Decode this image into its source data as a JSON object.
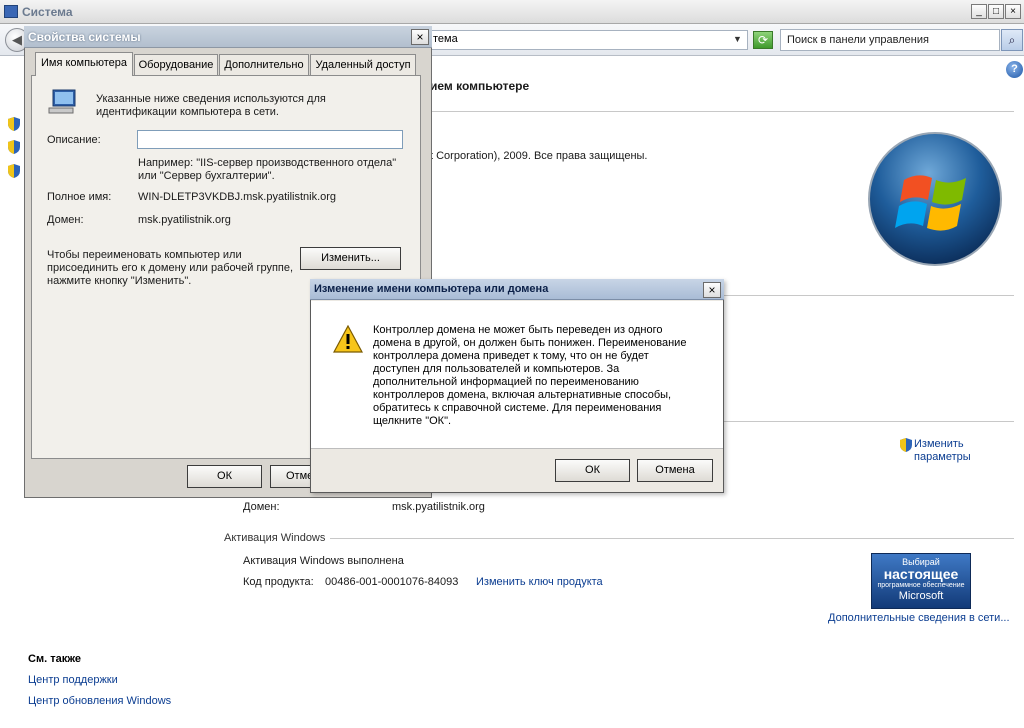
{
  "window": {
    "title": "Система",
    "controls": {
      "minimize": "_",
      "maximize": "□",
      "close": "×"
    }
  },
  "addressbar": {
    "address": "тема",
    "search_placeholder": "Поиск в панели управления",
    "help": "?"
  },
  "main": {
    "heading": "ием компьютере",
    "copyright": "t Corporation), 2009. Все права защищены.",
    "change_settings_label": "Изменить\nпараметры",
    "change_settings_line1": "Изменить",
    "change_settings_line2": "параметры",
    "domain_label": "Домен:",
    "domain_value": "msk.pyatilistnik.org",
    "activation_section": "Активация Windows",
    "activation_status": "Активация Windows выполнена",
    "product_key_label": "Код продукта:",
    "product_key_value": "00486-001-0001076-84093",
    "change_key_link": "Изменить ключ продукта",
    "genuine_line1": "Выбирай",
    "genuine_line2": "настоящее",
    "genuine_line3": "программное обеспечение",
    "genuine_line4": "Microsoft",
    "more_info_link": "Дополнительные сведения в сети...",
    "see_also_title": "См. также",
    "see_also_links": [
      "Центр поддержки",
      "Центр обновления Windows"
    ]
  },
  "sysprops": {
    "title": "Свойства системы",
    "close": "×",
    "tabs": [
      "Имя компьютера",
      "Оборудование",
      "Дополнительно",
      "Удаленный доступ"
    ],
    "intro_line1": "Указанные ниже сведения используются для",
    "intro_line2": "идентификации компьютера в сети.",
    "description_label": "Описание:",
    "description_value": "",
    "example_line1": "Например: \"IIS-сервер производственного отдела\"",
    "example_line2": "или \"Сервер бухгалтерии\".",
    "fullname_label": "Полное имя:",
    "fullname_value": "WIN-DLETP3VKDBJ.msk.pyatilistnik.org",
    "domain_label": "Домен:",
    "domain_value": "msk.pyatilistnik.org",
    "rename_line1": "Чтобы переименовать компьютер или",
    "rename_line2": "присоединить его к домену или рабочей группе,",
    "rename_line3": "нажмите кнопку \"Изменить\".",
    "change_button": "Изменить...",
    "ok_button": "ОК",
    "cancel_button_partial": "Отме"
  },
  "warning": {
    "title": "Изменение имени компьютера или домена",
    "close": "×",
    "message_lines": [
      "Контроллер домена не может быть переведен из одного",
      "домена в другой, он должен быть понижен. Переименование",
      "контроллера домена приведет к тому, что он не будет",
      "доступен для пользователей и компьютеров. За",
      "дополнительной информацией по переименованию",
      "контроллеров домена, включая альтернативные способы,",
      "обратитесь к справочной системе. Для переименования",
      "щелкните \"ОК\"."
    ],
    "ok_button": "ОК",
    "cancel_button": "Отмена"
  }
}
